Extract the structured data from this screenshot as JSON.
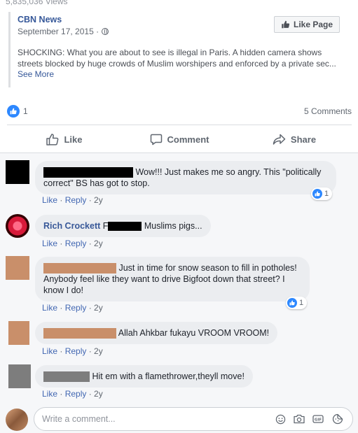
{
  "post": {
    "views": "5,835,036 Views",
    "source_name": "CBN News",
    "date": "September 17, 2015 · ",
    "like_page": "Like Page",
    "description": "SHOCKING: What you are about to see is illegal in Paris. A hidden camera shows streets blocked by huge crowds of Muslim worshipers and enforced by a private sec...",
    "see_more": "See More",
    "reaction_count": "1",
    "comments_count": "5 Comments"
  },
  "actions": {
    "like": "Like",
    "comment": "Comment",
    "share": "Share"
  },
  "comments": [
    {
      "name": "",
      "text": "Wow!!! Just makes me so angry. This \"politically correct\" BS has got to stop.",
      "like": "Like",
      "reply": "Reply",
      "time": "2y",
      "reactions": "1"
    },
    {
      "name": "Rich Crockett",
      "text_pre": "F",
      "text_post": "Muslims pigs...",
      "like": "Like",
      "reply": "Reply",
      "time": "2y"
    },
    {
      "name": "",
      "text_first": "Just in time for snow season to fill in potholes!",
      "text_rest": "Anybody feel like they want to drive Bigfoot down that street? I know I do!",
      "like": "Like",
      "reply": "Reply",
      "time": "2y",
      "reactions": "1"
    },
    {
      "name": "",
      "text": "Allah Ahkbar fukayu VROOM VROOM!",
      "like": "Like",
      "reply": "Reply",
      "time": "2y"
    },
    {
      "name": "",
      "text": "Hit em with a flamethrower,theyll move!",
      "like": "Like",
      "reply": "Reply",
      "time": "2y"
    }
  ],
  "composer": {
    "placeholder": "Write a comment..."
  },
  "colors": {
    "link": "#365899",
    "reaction_blue": "#2d88ff",
    "bubble": "#ebedf0",
    "redaction_tan": "#c98f6a",
    "redaction_gray": "#7d7d7d"
  },
  "icons": [
    "globe-icon",
    "thumbs-up-icon",
    "comment-icon",
    "share-icon",
    "emoji-icon",
    "camera-icon",
    "gif-icon",
    "sticker-icon"
  ]
}
